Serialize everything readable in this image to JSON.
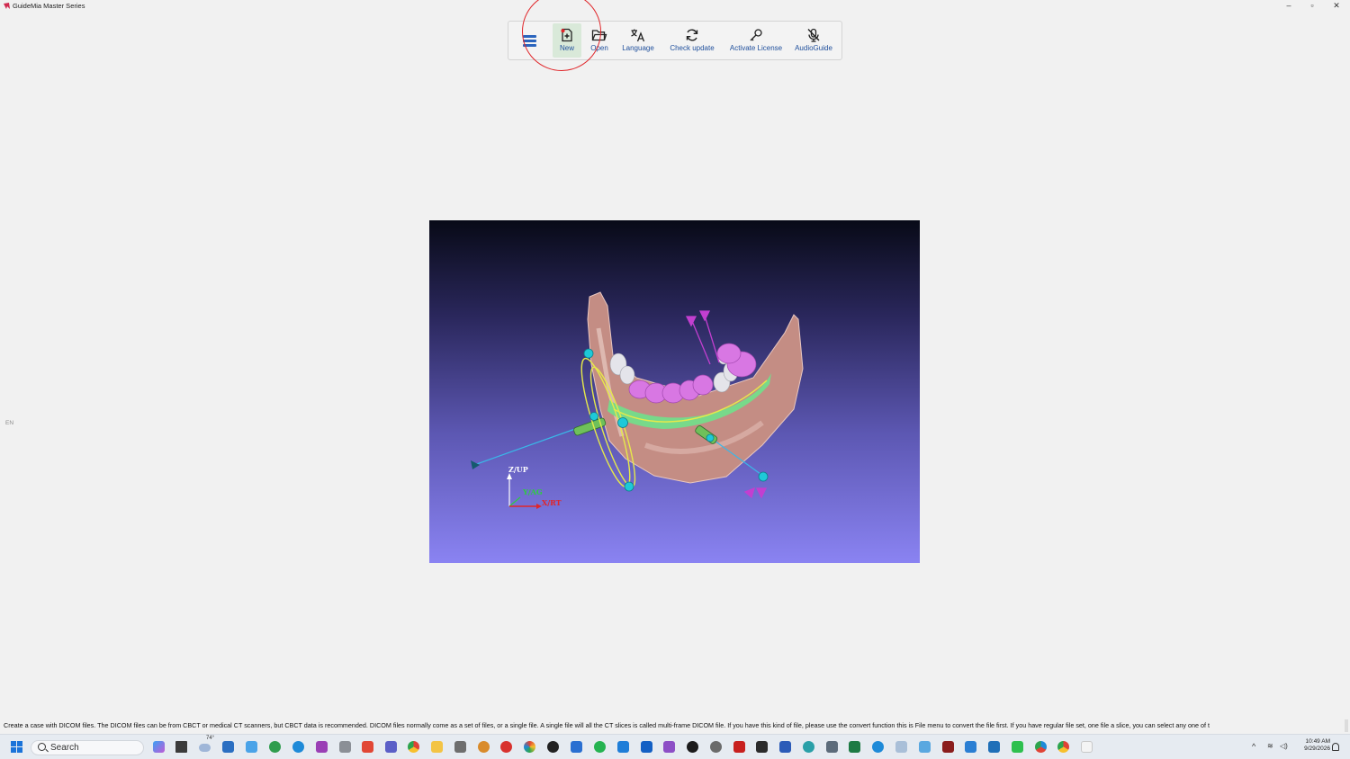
{
  "window": {
    "title": "GuideMia Master Series",
    "minimize_glyph": "–",
    "maximize_glyph": "▫",
    "close_glyph": "✕"
  },
  "toolbar": {
    "menu_icon": "hamburger-menu-icon",
    "buttons": [
      {
        "label": "New",
        "icon": "new-file-icon"
      },
      {
        "label": "Open",
        "icon": "folder-open-icon"
      },
      {
        "label": "Language",
        "icon": "translate-icon"
      },
      {
        "label": "Check update",
        "icon": "refresh-icon"
      },
      {
        "label": "Activate License",
        "icon": "key-icon"
      },
      {
        "label": "AudioGuide",
        "icon": "microphone-off-icon"
      }
    ]
  },
  "viewport": {
    "axis_z_label": "Z/UP",
    "axis_y_label": "Y/AG",
    "axis_x_label": "X/RT"
  },
  "side_indicator": "EN",
  "status_bar": {
    "text": "Create a case with DICOM files. The DICOM files can be from CBCT or medical CT scanners, but CBCT data is recommended. DICOM files normally come as a set of files, or a single file. A single file will all the CT slices is called multi-frame DICOM file. If you have this kind of file, please use the convert function this is File menu to convert the file first. If you have regular file set, one file a slice, you can select any one of t"
  },
  "taskbar": {
    "search_placeholder": "Search",
    "weather_temp": "74°",
    "time": "10:49 AM",
    "date": "9/29/2026"
  },
  "colors": {
    "accent": "#1f4f9c",
    "highlight_ring": "#e0262a",
    "new_button_bg": "#d9e9d9"
  }
}
